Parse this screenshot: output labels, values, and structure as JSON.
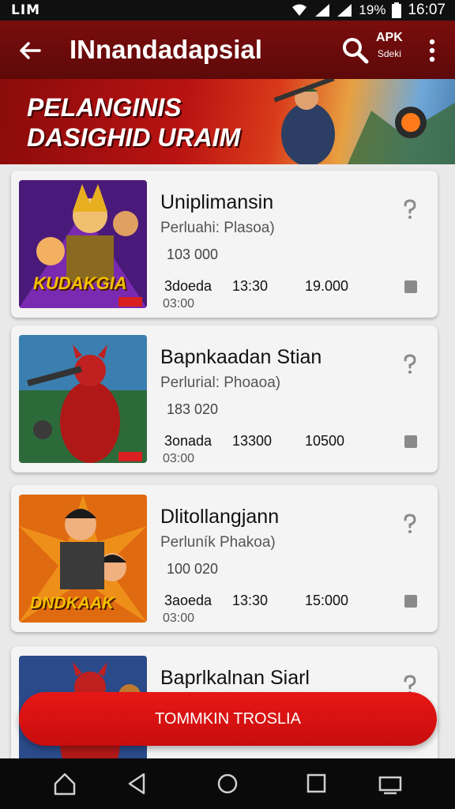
{
  "status_bar": {
    "carrier": "LIM",
    "battery": "19%",
    "time": "16:07"
  },
  "app_bar": {
    "title": "INnandadapsial",
    "apk_label": "APK",
    "apk_sub": "Sdeki",
    "icons": [
      "back-arrow-icon",
      "search-icon",
      "more-vert-icon"
    ]
  },
  "banner": {
    "line1": "PELANGINIS",
    "line2": "DASIGHID URAIM"
  },
  "games": [
    {
      "title": "Uniplimansin",
      "subtitle": "Perluahi: Plasoa)",
      "number": "103 000",
      "stat_a": "3doeda",
      "stat_b": "13:30",
      "stat_c": "19.000",
      "time": "03:00",
      "thumb_text": "KUDAKGIA"
    },
    {
      "title": "Bapnkaadan Stian",
      "subtitle": "Perlurial: Phoaoa)",
      "number": "183 020",
      "stat_a": "3onada",
      "stat_b": "13300",
      "stat_c": "10500",
      "time": "03:00",
      "thumb_text": ""
    },
    {
      "title": "Dlitollangjann",
      "subtitle": "Perluník Phakoa)",
      "number": "100 020",
      "stat_a": "3aoeda",
      "stat_b": "13:30",
      "stat_c": "15:000",
      "time": "03:00",
      "thumb_text": "DNDKAAK"
    },
    {
      "title": "Baprlkalnan Siarl",
      "subtitle": "",
      "number": "",
      "stat_a": "",
      "stat_b": "",
      "stat_c": "",
      "time": "",
      "thumb_text": ""
    }
  ],
  "cta": {
    "label": "TOMMKIN TROSLIA"
  },
  "nav_bar": {
    "icons": [
      "home-icon",
      "back-triangle-icon",
      "circle-home-icon",
      "recents-square-icon",
      "screen-icon"
    ]
  },
  "colors": {
    "app_bar": "#6b0b0b",
    "accent": "#d81212",
    "card_bg": "#f4f4f4"
  }
}
